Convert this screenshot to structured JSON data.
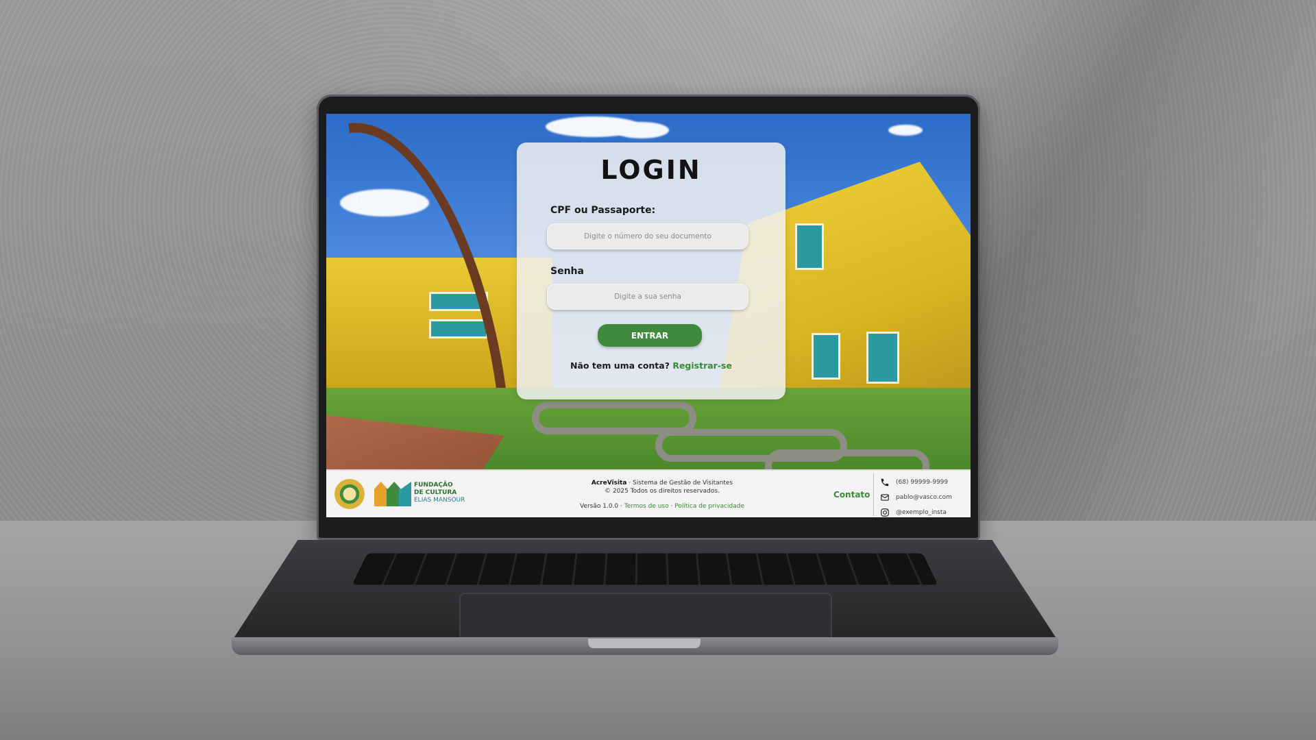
{
  "login": {
    "title": "LOGIN",
    "document_label": "CPF ou Passaporte:",
    "document_placeholder": "Digite o número do seu documento",
    "password_label": "Senha",
    "password_placeholder": "Digite a sua senha",
    "submit_label": "ENTRAR",
    "no_account_text": "Não tem uma conta?",
    "register_link": "Registrar-se"
  },
  "footer": {
    "logo_fundacao": [
      "FUNDAÇÃO",
      "DE CULTURA",
      "ELIAS MANSOUR"
    ],
    "app_name": "AcreVisita",
    "app_subtitle": "· Sistema de Gestão de Visitantes",
    "copyright": "© 2025 Todos os direitos reservados.",
    "version": "Versão 1.0.0 ·",
    "terms": "Termos de uso",
    "separator": "·",
    "privacy": "Política de privacidade",
    "contact_label": "Contato",
    "phone": "(68) 99999-9999",
    "email": "pablo@vasco.com",
    "instagram": "@exemplo_insta"
  },
  "colors": {
    "accent_green": "#3f8a3f",
    "link_green": "#3a8a33"
  },
  "icons": [
    "phone-icon",
    "mail-icon",
    "instagram-icon"
  ]
}
